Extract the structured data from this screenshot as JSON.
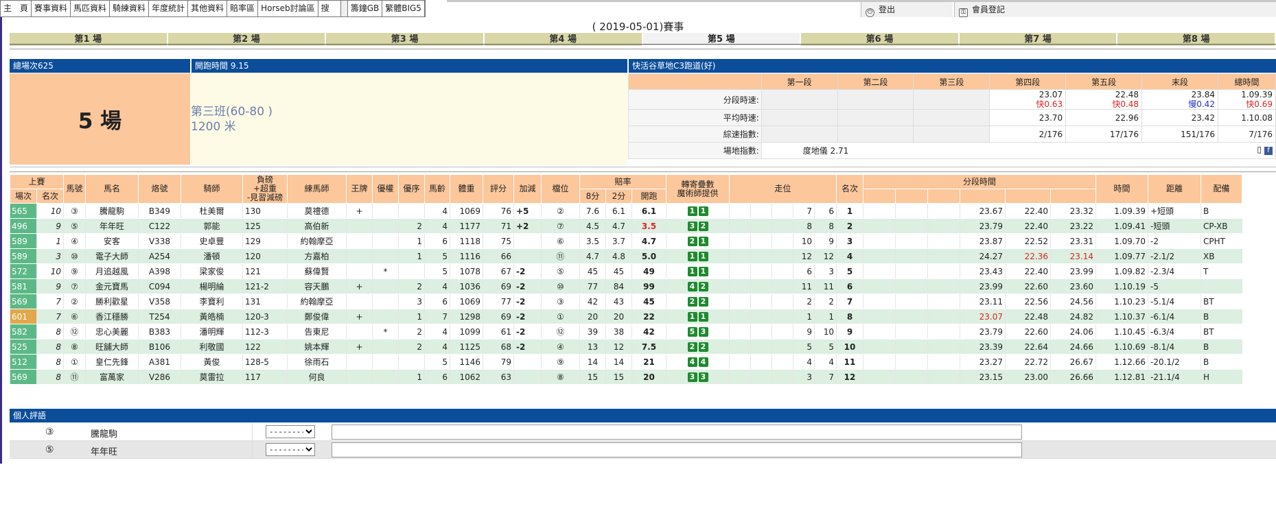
{
  "nav": {
    "items": [
      "主　頁",
      "賽事資料",
      "馬匹資料",
      "騎練資料",
      "年度統計",
      "其他資料",
      "賠率區",
      "Horseb討論區",
      "搜　",
      "",
      "籌鐘GB",
      "繁體BIG5"
    ],
    "logout": "登出",
    "member_login": "會員登記"
  },
  "page_title": "( 2019-05-01)賽事",
  "race_tabs": [
    "第1 場",
    "第2 場",
    "第3 場",
    "第4 場",
    "第5 場",
    "第6 場",
    "第7 場",
    "第8 場"
  ],
  "active_tab": 4,
  "race_info": {
    "total_races": "總場次625",
    "start_time": "開跑時間 9.15",
    "track": "快活谷草地C3跑道(好)",
    "race_no": "5 場",
    "class": "第三班(60-80 )",
    "distance": "1200 米"
  },
  "sectional": {
    "headers": [
      "",
      "第一段",
      "第二段",
      "第三段",
      "第四段",
      "第五段",
      "末段",
      "總時間"
    ],
    "rows": [
      {
        "label": "分段時速:",
        "cells": [
          "",
          "",
          "",
          {
            "v": "23.07",
            "d": "快0.63",
            "c": "red"
          },
          {
            "v": "22.48",
            "d": "快0.48",
            "c": "red"
          },
          {
            "v": "23.84",
            "d": "慢0.42",
            "c": "blue"
          },
          {
            "v": "1.09.39",
            "d": "快0.69",
            "c": "red"
          }
        ]
      },
      {
        "label": "平均時速:",
        "cells": [
          "",
          "",
          "",
          "23.70",
          "22.96",
          "23.42",
          "1.10.08"
        ]
      },
      {
        "label": "綜速指數:",
        "cells": [
          "",
          "",
          "",
          "2/176",
          "17/176",
          "151/176",
          "7/176"
        ]
      }
    ],
    "ground_label": "場地指數:",
    "ground_value": "度地儀  2.71"
  },
  "table": {
    "header1": [
      "上賽",
      "馬號",
      "馬名",
      "烙號",
      "騎師",
      "負磅\n+超重\n-見習減磅",
      "練馬師",
      "王牌",
      "優權",
      "優序",
      "馬齡",
      "體重",
      "評分",
      "加減",
      "檔位",
      "賠率",
      "轉寄疊數\n魔術師提供",
      "走位",
      "名次",
      "分段時間",
      "時間",
      "距離",
      "配備"
    ],
    "header2": [
      "場次",
      "名次",
      "8分",
      "2分",
      "開跑"
    ],
    "rows": [
      {
        "sc": "565",
        "rk": "10",
        "no": "③",
        "name": "騰龍駒",
        "brand": "B349",
        "jockey": "杜美爾",
        "wt": "130",
        "trainer": "莫禮德",
        "ace": "+",
        "pri": "",
        "ps": "",
        "age": "4",
        "bw": "1069",
        "rt": "76",
        "adj": "+5",
        "dr": "②",
        "o8": "7.6",
        "o2": "6.1",
        "oo": "6.1",
        "ooc": "",
        "m1": "1",
        "m2": "1",
        "pos": [
          "",
          "",
          "",
          "7",
          "6"
        ],
        "place": "1",
        "secs": [
          "",
          "",
          "",
          "23.67",
          "22.40",
          "23.32"
        ],
        "time": "1.09.39",
        "dist": "+短頭",
        "gear": "B"
      },
      {
        "sc": "496",
        "rk": "9",
        "no": "⑤",
        "name": "年年旺",
        "brand": "C122",
        "jockey": "郭能",
        "wt": "125",
        "trainer": "高伯新",
        "ace": "",
        "pri": "",
        "ps": "2",
        "age": "4",
        "bw": "1177",
        "rt": "71",
        "adj": "+2",
        "dr": "⑦",
        "o8": "4.5",
        "o2": "4.7",
        "oo": "3.5",
        "ooc": "red",
        "m1": "3",
        "m2": "2",
        "pos": [
          "",
          "",
          "",
          "8",
          "8"
        ],
        "place": "2",
        "secs": [
          "",
          "",
          "",
          "23.79",
          "22.40",
          "23.22"
        ],
        "time": "1.09.41",
        "dist": "-短頭",
        "gear": "CP-XB"
      },
      {
        "sc": "589",
        "rk": "1",
        "no": "④",
        "name": "安客",
        "brand": "V338",
        "jockey": "史卓豐",
        "wt": "129",
        "trainer": "約翰摩亞",
        "ace": "",
        "pri": "",
        "ps": "1",
        "age": "6",
        "bw": "1118",
        "rt": "75",
        "adj": "",
        "dr": "⑥",
        "o8": "3.5",
        "o2": "3.7",
        "oo": "4.7",
        "ooc": "",
        "m1": "2",
        "m2": "1",
        "pos": [
          "",
          "",
          "",
          "10",
          "9"
        ],
        "place": "3",
        "secs": [
          "",
          "",
          "",
          "23.87",
          "22.52",
          "23.31"
        ],
        "time": "1.09.70",
        "dist": "-2",
        "gear": "CPHT"
      },
      {
        "sc": "589",
        "rk": "3",
        "no": "⑩",
        "name": "電子大師",
        "brand": "A254",
        "jockey": "潘頓",
        "wt": "120",
        "trainer": "方嘉柏",
        "ace": "",
        "pri": "",
        "ps": "1",
        "age": "5",
        "bw": "1116",
        "rt": "66",
        "adj": "",
        "dr": "⑪",
        "o8": "4.7",
        "o2": "4.8",
        "oo": "5.0",
        "ooc": "",
        "m1": "1",
        "m2": "1",
        "pos": [
          "",
          "",
          "",
          "12",
          "12"
        ],
        "place": "4",
        "secs": [
          "",
          "",
          "",
          "24.27",
          "22.36",
          "23.14"
        ],
        "secsRed": [
          4,
          5
        ],
        "time": "1.09.77",
        "dist": "-2.1/2",
        "gear": "XB"
      },
      {
        "sc": "572",
        "rk": "10",
        "no": "⑨",
        "name": "月追越風",
        "brand": "A398",
        "jockey": "梁家俊",
        "wt": "121",
        "trainer": "蘇偉賢",
        "ace": "",
        "pri": "*",
        "ps": "",
        "age": "5",
        "bw": "1078",
        "rt": "67",
        "adj": "-2",
        "dr": "⑤",
        "o8": "45",
        "o2": "45",
        "oo": "49",
        "ooc": "",
        "m1": "1",
        "m2": "1",
        "pos": [
          "",
          "",
          "",
          "6",
          "3"
        ],
        "place": "5",
        "secs": [
          "",
          "",
          "",
          "23.43",
          "22.40",
          "23.99"
        ],
        "time": "1.09.82",
        "dist": "-2.3/4",
        "gear": "T"
      },
      {
        "sc": "581",
        "rk": "9",
        "no": "⑦",
        "name": "金元寶馬",
        "brand": "C094",
        "jockey": "楊明綸",
        "wt": "121-2",
        "trainer": "容天鵬",
        "ace": "+",
        "pri": "",
        "ps": "2",
        "age": "4",
        "bw": "1036",
        "rt": "69",
        "adj": "-2",
        "dr": "⑩",
        "o8": "77",
        "o2": "84",
        "oo": "99",
        "ooc": "",
        "m1": "4",
        "m2": "2",
        "pos": [
          "",
          "",
          "",
          "11",
          "11"
        ],
        "place": "6",
        "secs": [
          "",
          "",
          "",
          "23.99",
          "22.60",
          "23.60"
        ],
        "time": "1.10.19",
        "dist": "-5",
        "gear": ""
      },
      {
        "sc": "569",
        "rk": "7",
        "no": "②",
        "name": "勝利歡星",
        "brand": "V358",
        "jockey": "李寶利",
        "wt": "131",
        "trainer": "約翰摩亞",
        "ace": "",
        "pri": "",
        "ps": "3",
        "age": "6",
        "bw": "1069",
        "rt": "77",
        "adj": "-2",
        "dr": "③",
        "o8": "42",
        "o2": "43",
        "oo": "45",
        "ooc": "",
        "m1": "2",
        "m2": "2",
        "pos": [
          "",
          "",
          "",
          "2",
          "2"
        ],
        "place": "7",
        "secs": [
          "",
          "",
          "",
          "23.11",
          "22.56",
          "24.56"
        ],
        "time": "1.10.23",
        "dist": "-5.1/4",
        "gear": "BT"
      },
      {
        "sc": "601",
        "rk": "7",
        "no": "⑥",
        "name": "香江穩勝",
        "brand": "T254",
        "jockey": "黃皓楠",
        "wt": "120-3",
        "trainer": "鄭俊偉",
        "ace": "+",
        "pri": "",
        "ps": "1",
        "age": "7",
        "bw": "1298",
        "rt": "69",
        "adj": "-2",
        "dr": "①",
        "o8": "20",
        "o2": "20",
        "oo": "22",
        "ooc": "",
        "m1": "1",
        "m2": "1",
        "pos": [
          "",
          "",
          "",
          "1",
          "1"
        ],
        "place": "8",
        "secs": [
          "",
          "",
          "",
          "23.07",
          "22.48",
          "24.82"
        ],
        "secsRed": [
          3
        ],
        "time": "1.10.37",
        "dist": "-6.1/4",
        "gear": "B",
        "gold": true
      },
      {
        "sc": "582",
        "rk": "8",
        "no": "⑫",
        "name": "忠心美麗",
        "brand": "B383",
        "jockey": "潘明輝",
        "wt": "112-3",
        "trainer": "告東尼",
        "ace": "",
        "pri": "*",
        "ps": "2",
        "age": "4",
        "bw": "1099",
        "rt": "61",
        "adj": "-2",
        "dr": "⑫",
        "o8": "39",
        "o2": "38",
        "oo": "42",
        "ooc": "",
        "m1": "5",
        "m2": "3",
        "pos": [
          "",
          "",
          "",
          "9",
          "10"
        ],
        "place": "9",
        "secs": [
          "",
          "",
          "",
          "23.79",
          "22.60",
          "24.06"
        ],
        "time": "1.10.45",
        "dist": "-6.3/4",
        "gear": "BT"
      },
      {
        "sc": "525",
        "rk": "8",
        "no": "⑧",
        "name": "旺舖大師",
        "brand": "B106",
        "jockey": "利敬國",
        "wt": "122",
        "trainer": "姚本輝",
        "ace": "+",
        "pri": "",
        "ps": "2",
        "age": "4",
        "bw": "1125",
        "rt": "68",
        "adj": "-2",
        "dr": "④",
        "o8": "13",
        "o2": "12",
        "oo": "7.5",
        "ooc": "",
        "m1": "2",
        "m2": "2",
        "pos": [
          "",
          "",
          "",
          "5",
          "5"
        ],
        "place": "10",
        "secs": [
          "",
          "",
          "",
          "23.39",
          "22.64",
          "24.66"
        ],
        "time": "1.10.69",
        "dist": "-8.1/4",
        "gear": "B"
      },
      {
        "sc": "512",
        "rk": "8",
        "no": "①",
        "name": "皇仁先鋒",
        "brand": "A381",
        "jockey": "黃俊",
        "wt": "128-5",
        "trainer": "徐雨石",
        "ace": "",
        "pri": "",
        "ps": "",
        "age": "5",
        "bw": "1146",
        "rt": "79",
        "adj": "",
        "dr": "⑨",
        "o8": "14",
        "o2": "14",
        "oo": "21",
        "ooc": "",
        "m1": "4",
        "m2": "4",
        "pos": [
          "",
          "",
          "",
          "4",
          "4"
        ],
        "place": "11",
        "secs": [
          "",
          "",
          "",
          "23.27",
          "22.72",
          "26.67"
        ],
        "time": "1.12.66",
        "dist": "-20.1/2",
        "gear": "B"
      },
      {
        "sc": "569",
        "rk": "8",
        "no": "⑪",
        "name": "富萬家",
        "brand": "V286",
        "jockey": "莫雷拉",
        "wt": "117",
        "trainer": "何良",
        "ace": "",
        "pri": "",
        "ps": "1",
        "age": "6",
        "bw": "1062",
        "rt": "63",
        "adj": "",
        "dr": "⑧",
        "o8": "15",
        "o2": "15",
        "oo": "20",
        "ooc": "",
        "m1": "3",
        "m2": "3",
        "pos": [
          "",
          "",
          "",
          "3",
          "7"
        ],
        "place": "12",
        "secs": [
          "",
          "",
          "",
          "23.15",
          "23.00",
          "26.66"
        ],
        "time": "1.12.81",
        "dist": "-21.1/4",
        "gear": "H"
      }
    ]
  },
  "comments": {
    "title": "個人評語",
    "rows": [
      {
        "no": "③",
        "name": "騰龍駒",
        "select": "--------"
      },
      {
        "no": "⑤",
        "name": "年年旺",
        "select": "--------"
      }
    ]
  }
}
